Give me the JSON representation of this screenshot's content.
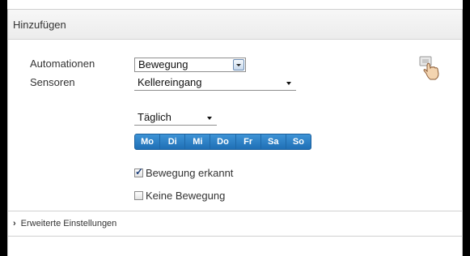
{
  "panel": {
    "title": "Hinzufügen"
  },
  "form": {
    "automationen_label": "Automationen",
    "automationen_value": "Bewegung",
    "sensoren_label": "Sensoren",
    "sensoren_value": "Kellereingang",
    "schedule_value": "Täglich",
    "days": [
      "Mo",
      "Di",
      "Mi",
      "Do",
      "Fr",
      "Sa",
      "So"
    ],
    "checkbox_detected": {
      "label": "Bewegung erkannt",
      "checked": true
    },
    "checkbox_none": {
      "label": "Keine Bewegung",
      "checked": false
    }
  },
  "advanced": {
    "label": "Erweiterte Einstellungen"
  },
  "icons": {
    "corner": "hand-pointer-icon",
    "expand": "chevron-right-icon"
  },
  "colors": {
    "day_button": "#2a7fc6",
    "frame": "#000000"
  }
}
